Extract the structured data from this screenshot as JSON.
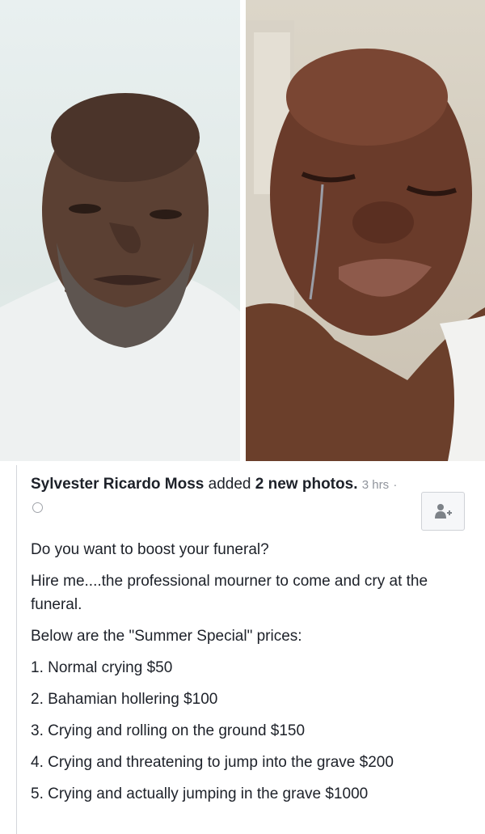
{
  "post": {
    "author": "Sylvester Ricardo Moss",
    "action_text": " added ",
    "count_text": "2 new photos",
    "separator": ".",
    "timestamp": "3 hrs",
    "dot": "·",
    "paragraphs": [
      "Do you want to boost your funeral?",
      "Hire me....the professional mourner to come and cry at the funeral.",
      "Below are the \"Summer Special\" prices:"
    ],
    "price_list": [
      "1. Normal crying $50",
      "2. Bahamian hollering $100",
      "3. Crying and rolling on the ground $150",
      "4. Crying and threatening to jump into the grave $200",
      "5. Crying and actually jumping in the grave $1000"
    ]
  },
  "colors": {
    "text": "#1d2129",
    "meta": "#90949c",
    "border": "#d3d6db"
  }
}
